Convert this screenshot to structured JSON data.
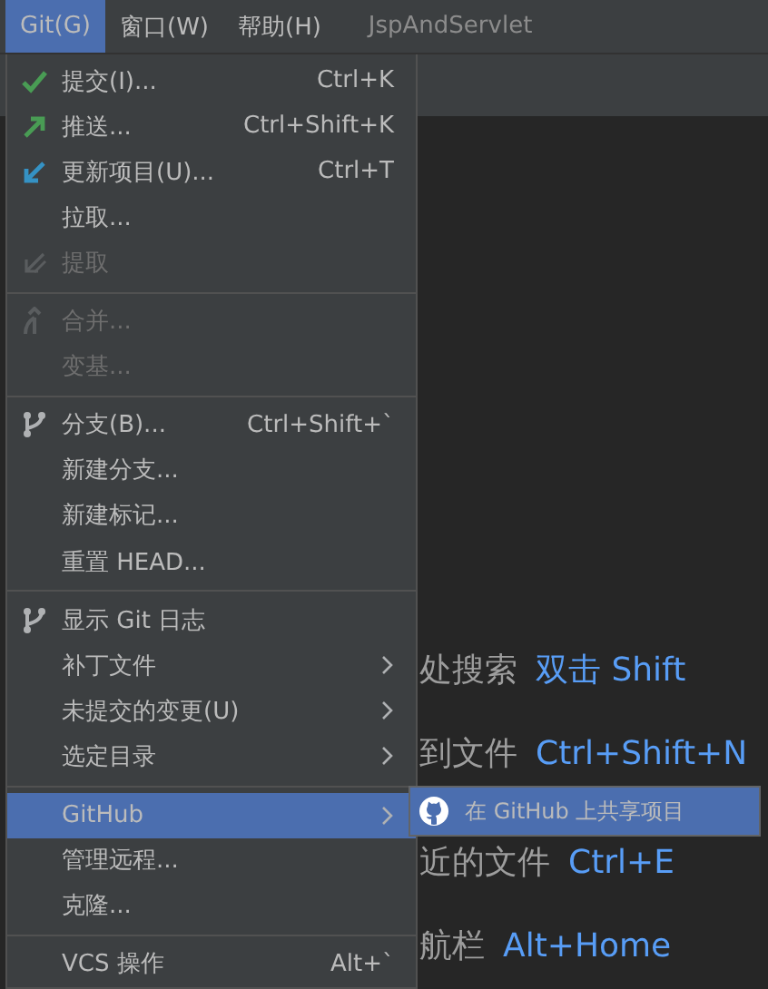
{
  "menubar": [
    {
      "label": "Git(G)",
      "selected": true
    },
    {
      "label": "窗口(W)",
      "selected": false
    },
    {
      "label": "帮助(H)",
      "selected": false
    }
  ],
  "project_title": "JspAndServlet",
  "hints": [
    {
      "label": "处搜索",
      "shortcut": "双击 Shift"
    },
    {
      "label": "到文件",
      "shortcut": "Ctrl+Shift+N"
    },
    {
      "label": "近的文件",
      "shortcut": "Ctrl+E"
    },
    {
      "label": "航栏",
      "shortcut": "Alt+Home"
    }
  ],
  "menu": [
    {
      "kind": "item",
      "label": "提交(I)...",
      "shortcut": "Ctrl+K",
      "disabled": false,
      "submenu": false,
      "selected": false
    },
    {
      "kind": "item",
      "label": "推送...",
      "shortcut": "Ctrl+Shift+K",
      "disabled": false,
      "submenu": false,
      "selected": false
    },
    {
      "kind": "item",
      "label": "更新项目(U)...",
      "shortcut": "Ctrl+T",
      "disabled": false,
      "submenu": false,
      "selected": false
    },
    {
      "kind": "item",
      "label": "拉取...",
      "disabled": false,
      "submenu": false,
      "selected": false
    },
    {
      "kind": "item",
      "label": "提取",
      "disabled": true,
      "submenu": false,
      "selected": false
    },
    {
      "kind": "separator"
    },
    {
      "kind": "item",
      "label": "合并...",
      "disabled": true,
      "submenu": false,
      "selected": false
    },
    {
      "kind": "item",
      "label": "变基...",
      "disabled": true,
      "submenu": false,
      "selected": false
    },
    {
      "kind": "separator"
    },
    {
      "kind": "item",
      "label": "分支(B)...",
      "shortcut": "Ctrl+Shift+`",
      "disabled": false,
      "submenu": false,
      "selected": false
    },
    {
      "kind": "item",
      "label": "新建分支...",
      "disabled": false,
      "submenu": false,
      "selected": false
    },
    {
      "kind": "item",
      "label": "新建标记...",
      "disabled": false,
      "submenu": false,
      "selected": false
    },
    {
      "kind": "item",
      "label": "重置 HEAD...",
      "disabled": false,
      "submenu": false,
      "selected": false
    },
    {
      "kind": "separator"
    },
    {
      "kind": "item",
      "label": "显示 Git 日志",
      "disabled": false,
      "submenu": false,
      "selected": false
    },
    {
      "kind": "item",
      "label": "补丁文件",
      "disabled": false,
      "submenu": true,
      "selected": false
    },
    {
      "kind": "item",
      "label": "未提交的变更(U)",
      "disabled": false,
      "submenu": true,
      "selected": false
    },
    {
      "kind": "item",
      "label": "选定目录",
      "disabled": false,
      "submenu": true,
      "selected": false
    },
    {
      "kind": "separator"
    },
    {
      "kind": "item",
      "label": "GitHub",
      "disabled": false,
      "submenu": true,
      "selected": true
    },
    {
      "kind": "item",
      "label": "管理远程...",
      "disabled": false,
      "submenu": false,
      "selected": false
    },
    {
      "kind": "item",
      "label": "克隆...",
      "disabled": false,
      "submenu": false,
      "selected": false
    },
    {
      "kind": "separator"
    },
    {
      "kind": "item",
      "label": "VCS 操作",
      "shortcut": "Alt+`",
      "disabled": false,
      "submenu": false,
      "selected": false
    }
  ],
  "submenu": [
    {
      "label": "在 GitHub 上共享项目",
      "selected": true
    }
  ]
}
